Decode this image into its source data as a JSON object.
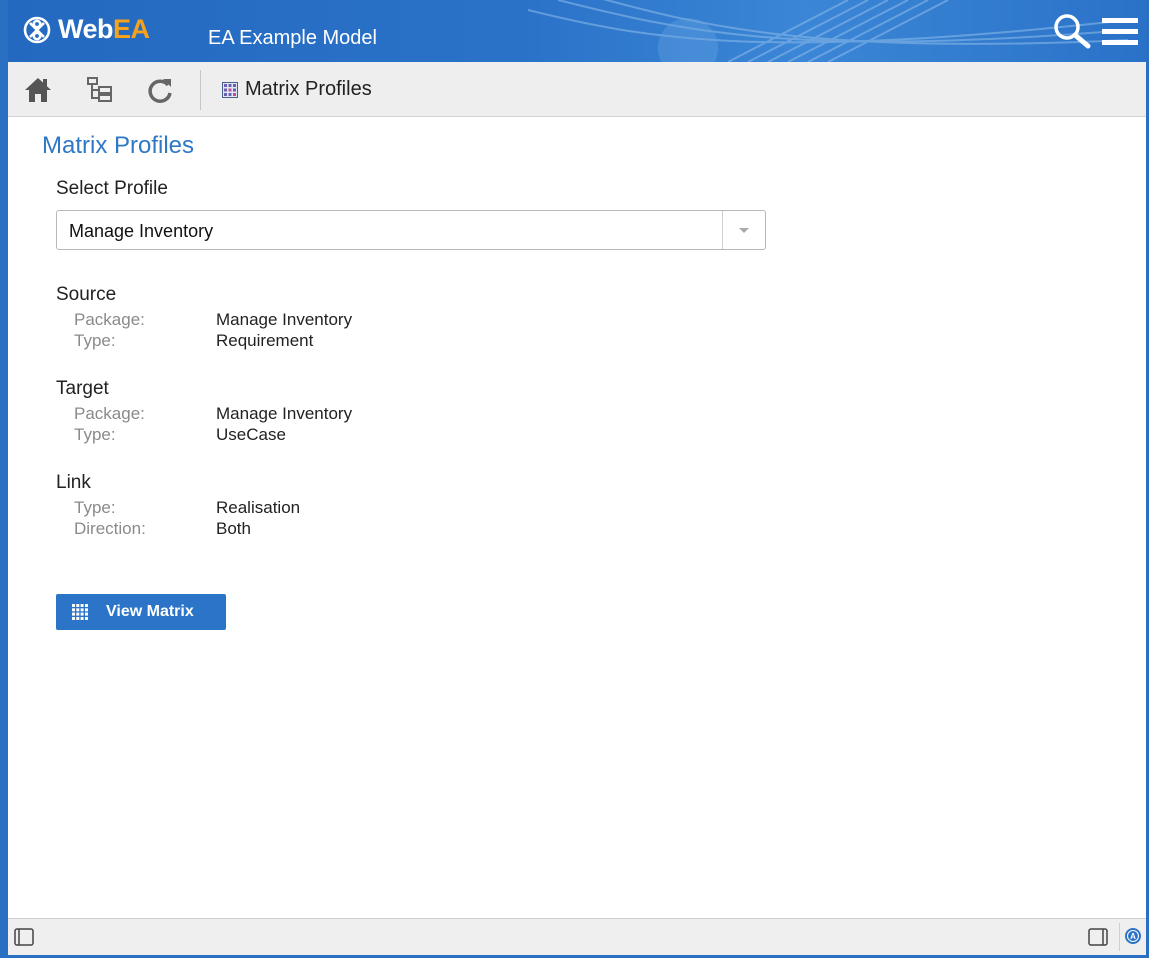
{
  "header": {
    "logo_text_prefix": "Web",
    "logo_text_suffix": "EA",
    "model_name": "EA Example Model",
    "icons": [
      "logo-icon",
      "search-icon",
      "hamburger-menu-icon"
    ]
  },
  "toolbar": {
    "icons": [
      "home-icon",
      "tree-icon",
      "refresh-icon"
    ],
    "breadcrumb_icon": "matrix-icon",
    "breadcrumb_label": "Matrix Profiles"
  },
  "main": {
    "title": "Matrix Profiles",
    "select_label": "Select Profile",
    "select_value": "Manage Inventory",
    "source": {
      "heading": "Source",
      "package_key": "Package:",
      "package_val": "Manage Inventory",
      "type_key": "Type:",
      "type_val": "Requirement"
    },
    "target": {
      "heading": "Target",
      "package_key": "Package:",
      "package_val": "Manage Inventory",
      "type_key": "Type:",
      "type_val": "UseCase"
    },
    "link": {
      "heading": "Link",
      "type_key": "Type:",
      "type_val": "Realisation",
      "direction_key": "Direction:",
      "direction_val": "Both"
    },
    "view_button_label": "View Matrix"
  },
  "statusbar": {
    "icons": [
      "left-panel-icon",
      "right-panel-icon",
      "status-indicator-icon"
    ],
    "status_letter": "A"
  },
  "colors": {
    "brand_blue": "#2a6fc2",
    "accent_orange": "#f7a21b",
    "title_blue": "#2f78c6",
    "button_blue": "#2c74c7"
  }
}
